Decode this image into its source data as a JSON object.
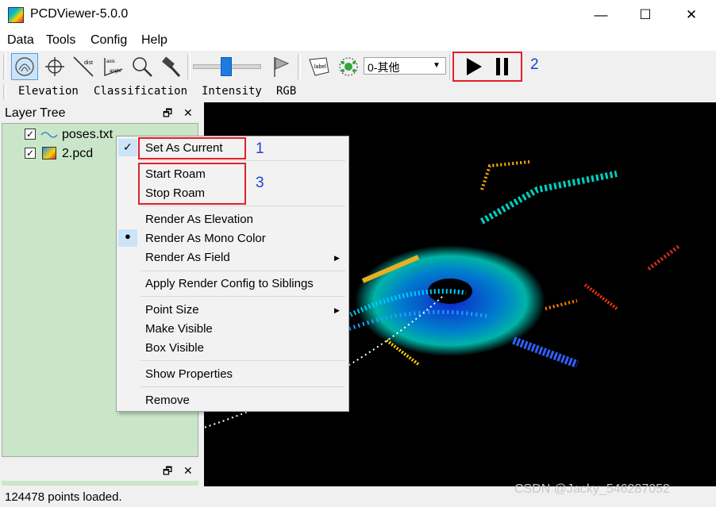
{
  "window": {
    "title": "PCDViewer-5.0.0",
    "minimize": "—",
    "maximize": "☐",
    "close": "✕"
  },
  "menubar": [
    "Data",
    "Tools",
    "Config",
    "Help"
  ],
  "toolbar": {
    "combo_value": "0-其他",
    "dist_label": "dist",
    "axis_label": "axis",
    "angle_label": "angle",
    "label_icon_text": "label"
  },
  "render_modes": [
    "Elevation",
    "Classification",
    "Intensity",
    "RGB"
  ],
  "layer_tree": {
    "title": "Layer Tree",
    "float_icon": "🗗",
    "close_icon": "✕",
    "layers": [
      {
        "name": "poses.txt",
        "checked": true
      },
      {
        "name": "2.pcd",
        "checked": true
      }
    ]
  },
  "status": "124478 points loaded.",
  "context_menu": {
    "items": [
      {
        "label": "Set As Current",
        "checked": true
      },
      {
        "label": "Start Roam"
      },
      {
        "label": "Stop Roam"
      },
      {
        "label": "Render As Elevation"
      },
      {
        "label": "Render As Mono Color",
        "selected": true
      },
      {
        "label": "Render As Field",
        "submenu": true
      },
      {
        "label": "Apply Render Config to Siblings"
      },
      {
        "label": "Point Size",
        "submenu": true
      },
      {
        "label": "Make Visible"
      },
      {
        "label": "Box Visible"
      },
      {
        "label": "Show Properties"
      },
      {
        "label": "Remove"
      }
    ]
  },
  "annotations": [
    "1",
    "2",
    "3"
  ],
  "watermark": "CSDN @Jacky_546287052",
  "colors": {
    "annotation_box": "#e0202a",
    "annotation_number": "#2040d0",
    "layer_bg": "#c9e6c9",
    "highlight": "#cce4f7"
  }
}
